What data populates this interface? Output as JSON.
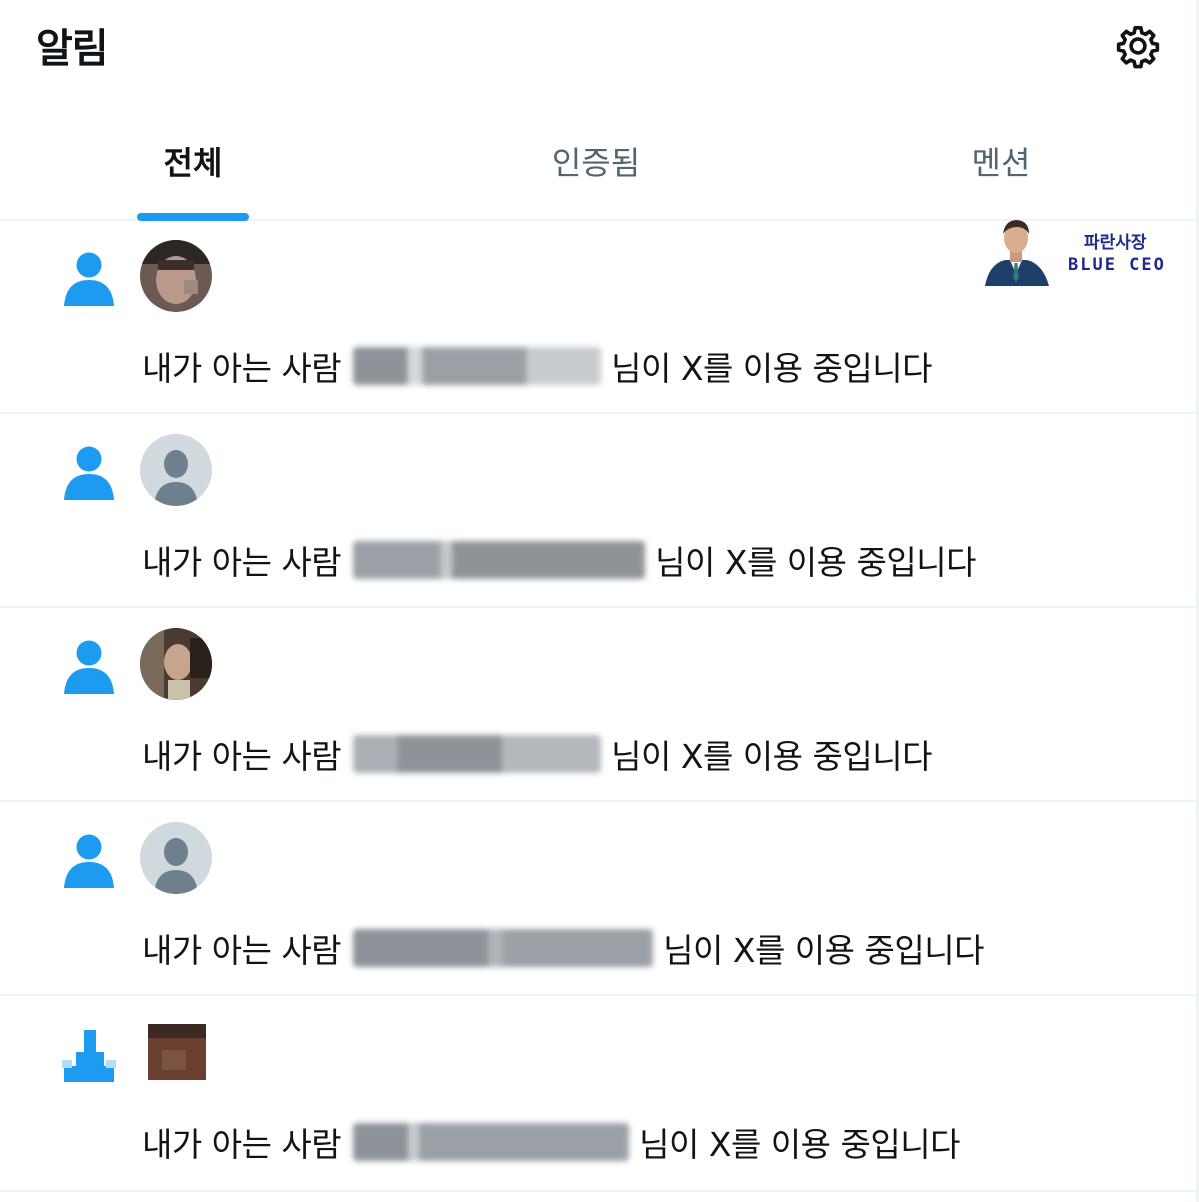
{
  "header": {
    "title": "알림",
    "settings_icon": "gear-icon"
  },
  "tabs": [
    {
      "label": "전체",
      "active": true
    },
    {
      "label": "인증됨",
      "active": false
    },
    {
      "label": "멘션",
      "active": false
    }
  ],
  "watermark": {
    "korean": "파란사장",
    "english": "BLUE CEO"
  },
  "notifications": [
    {
      "prefix": "내가 아는 사람",
      "suffix": "님이 X를 이용 중입니다",
      "icon": "person-icon",
      "avatar": "photo"
    },
    {
      "prefix": "내가 아는 사람",
      "suffix": "님이 X를 이용 중입니다",
      "icon": "person-icon",
      "avatar": "default"
    },
    {
      "prefix": "내가 아는 사람",
      "suffix": "님이 X를 이용 중입니다",
      "icon": "person-icon",
      "avatar": "photo"
    },
    {
      "prefix": "내가 아는 사람",
      "suffix": "님이 X를 이용 중입니다",
      "icon": "person-icon",
      "avatar": "default"
    },
    {
      "prefix": "내가 아는 사람",
      "suffix": "님이 X를 이용 중입니다",
      "icon": "person-icon",
      "avatar": "photo"
    }
  ],
  "colors": {
    "accent": "#1d9bf0",
    "text": "#0f1419",
    "muted": "#536471",
    "border": "#eff3f4"
  }
}
